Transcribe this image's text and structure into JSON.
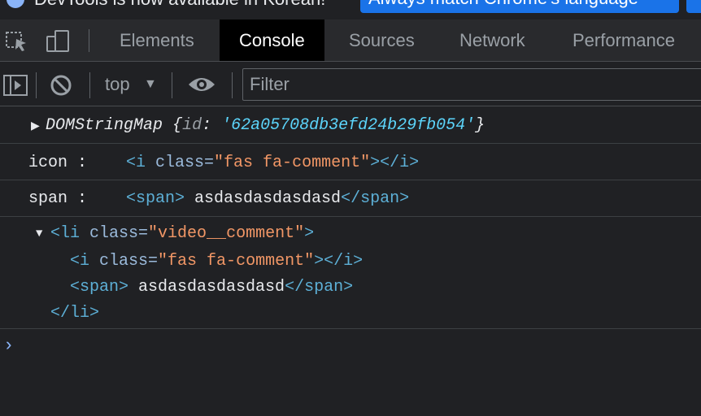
{
  "notification": {
    "text": "DevTools is now available in Korean!",
    "button_label": "Always match Chrome's language"
  },
  "tabs": [
    {
      "label": "Elements",
      "active": false
    },
    {
      "label": "Console",
      "active": true
    },
    {
      "label": "Sources",
      "active": false
    },
    {
      "label": "Network",
      "active": false
    },
    {
      "label": "Performance",
      "active": false
    }
  ],
  "toolbar": {
    "context": "top",
    "filter_placeholder": "Filter"
  },
  "console": {
    "dataset": {
      "type": "DOMStringMap",
      "open": "{",
      "key": "id",
      "colon": ":",
      "value": "'62a05708db3efd24b29fb054'",
      "close": "}"
    },
    "icon_log": {
      "label": "icon :",
      "open_tag": "<i",
      "attr": "class=",
      "attr_value": "\"fas fa-comment\"",
      "close_tag": "></i>"
    },
    "span_log": {
      "label": "span :",
      "open_tag": "<span>",
      "text": "asdasdasdasdasd",
      "close_tag": "</span>"
    },
    "li_tree": {
      "open_tag": "<li",
      "attr": "class=",
      "attr_value": "\"video__comment\"",
      "open_tag_end": ">",
      "child_i_open": "<i",
      "child_i_attr": "class=",
      "child_i_value": "\"fas fa-comment\"",
      "child_i_close": "></i>",
      "child_span_open": "<span>",
      "child_span_text": "asdasdasdasdasd",
      "child_span_close": "</span>",
      "close_tag": "</li>"
    },
    "prompt_symbol": "›"
  },
  "colors": {
    "background": "#202124",
    "tabbar": "#292a2d",
    "accent": "#1a73e8",
    "tag": "#5db0d7",
    "attr_value": "#f29766",
    "string": "#5cd5fb"
  }
}
